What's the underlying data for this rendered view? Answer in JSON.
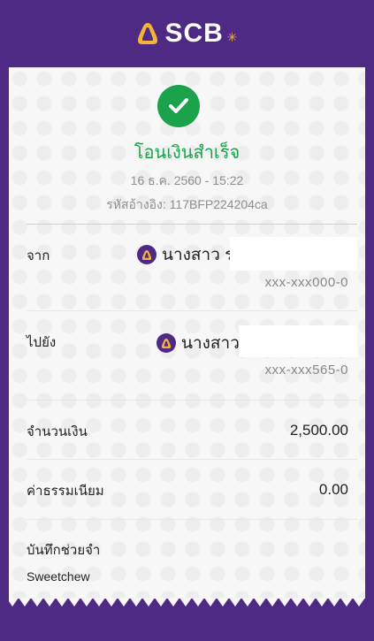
{
  "header": {
    "brand": "SCB"
  },
  "receipt": {
    "title": "โอนเงินสำเร็จ",
    "datetime": "16 ธ.ค. 2560 - 15:22",
    "reference": "รหัสอ้างอิง: 117BFP224204ca",
    "from": {
      "label": "จาก",
      "name": "นางสาว ร",
      "account": "xxx-xxx000-0"
    },
    "to": {
      "label": "ไปยัง",
      "name": "นางสาว",
      "account": "xxx-xxx565-0"
    },
    "amount": {
      "label": "จำนวนเงิน",
      "value": "2,500.00"
    },
    "fee": {
      "label": "ค่าธรรมเนียม",
      "value": "0.00"
    },
    "memo": {
      "label": "บันทึกช่วยจำ",
      "value": "Sweetchew"
    }
  },
  "colors": {
    "brand_purple": "#4e2a84",
    "success_green": "#1ba34b",
    "brand_gold": "#f5b335"
  },
  "icons": {
    "logo": "scb-bell-icon",
    "success": "check-circle-icon",
    "bank": "scb-bank-icon"
  }
}
